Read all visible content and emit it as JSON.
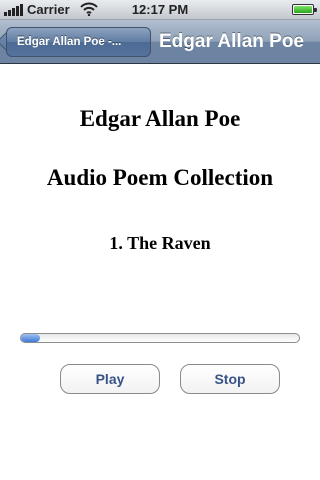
{
  "status_bar": {
    "carrier": "Carrier",
    "time": "12:17 PM"
  },
  "nav_bar": {
    "back_label": "Edgar Allan Poe -...",
    "title": "Edgar Allan Poe"
  },
  "main": {
    "title": "Edgar Allan Poe",
    "subtitle": "Audio Poem Collection",
    "track": "1. The Raven",
    "progress": 0.07,
    "play_label": "Play",
    "stop_label": "Stop"
  },
  "colors": {
    "nav_bar": "#6d84a2",
    "button_text": "#385487",
    "progress_fill": "#3d7ad6"
  },
  "icons": [
    "signal-icon",
    "wifi-icon",
    "battery-icon",
    "back-arrow-icon"
  ]
}
